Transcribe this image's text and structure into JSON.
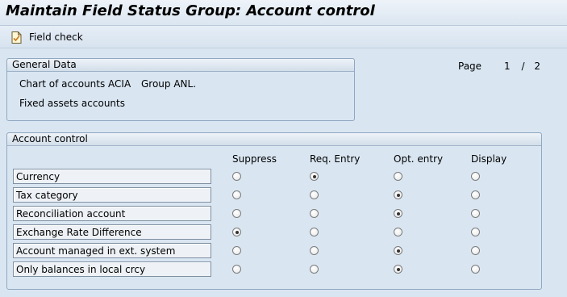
{
  "window": {
    "title": "Maintain Field Status Group: Account control"
  },
  "toolbar": {
    "field_check_label": "Field check",
    "field_check_icon": "document-check-icon"
  },
  "general": {
    "header": "General Data",
    "chart_label": "Chart of accounts ACIA",
    "group_label": "Group ANL.",
    "group_desc": "Fixed assets accounts"
  },
  "pager": {
    "label": "Page",
    "current": "1",
    "separator": "/",
    "total": "2"
  },
  "account_control": {
    "header": "Account control",
    "columns": [
      "Suppress",
      "Req. Entry",
      "Opt. entry",
      "Display"
    ],
    "rows": [
      {
        "label": "Currency",
        "selected": "Req. Entry"
      },
      {
        "label": "Tax category",
        "selected": "Opt. entry"
      },
      {
        "label": "Reconciliation account",
        "selected": "Opt. entry"
      },
      {
        "label": "Exchange Rate Difference",
        "selected": "Suppress"
      },
      {
        "label": "Account managed in ext. system",
        "selected": "Opt. entry"
      },
      {
        "label": "Only balances in local crcy",
        "selected": "Opt. entry"
      }
    ]
  }
}
